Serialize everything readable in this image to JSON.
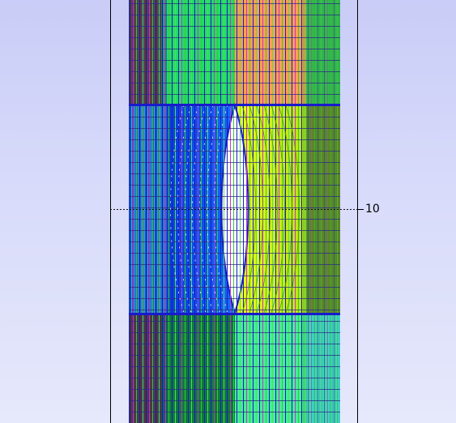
{
  "viewport": {
    "axis_tick_label": "10",
    "colors": {
      "background_top": "#c9cdf7",
      "background_bottom": "#e6e8fb",
      "frame_line": "#000000",
      "mesh_line_blue": "#1a1acc",
      "mesh_line_magenta": "#cc33cc",
      "mesh_line_green": "#33cc33",
      "mesh_line_dark": "#222222"
    },
    "zones": [
      {
        "name": "upper-brown",
        "fill": "#7a4416"
      },
      {
        "name": "upper-green",
        "fill": "#22dd66"
      },
      {
        "name": "upper-orange",
        "fill": "#ffa050"
      },
      {
        "name": "upper-right-green",
        "fill": "#33bb55"
      },
      {
        "name": "middle-cyan",
        "fill": "#2ea6e6"
      },
      {
        "name": "middle-blue",
        "fill": "#0b4fe0"
      },
      {
        "name": "middle-yellowgreen",
        "fill": "#d8f51c"
      },
      {
        "name": "middle-right-green",
        "fill": "#6a7a22"
      },
      {
        "name": "lower-brown",
        "fill": "#6a3a12"
      },
      {
        "name": "lower-darkgreen",
        "fill": "#0d7a3a"
      },
      {
        "name": "lower-lightgreen",
        "fill": "#44ee99"
      },
      {
        "name": "lower-cyan",
        "fill": "#44ddee"
      }
    ]
  }
}
